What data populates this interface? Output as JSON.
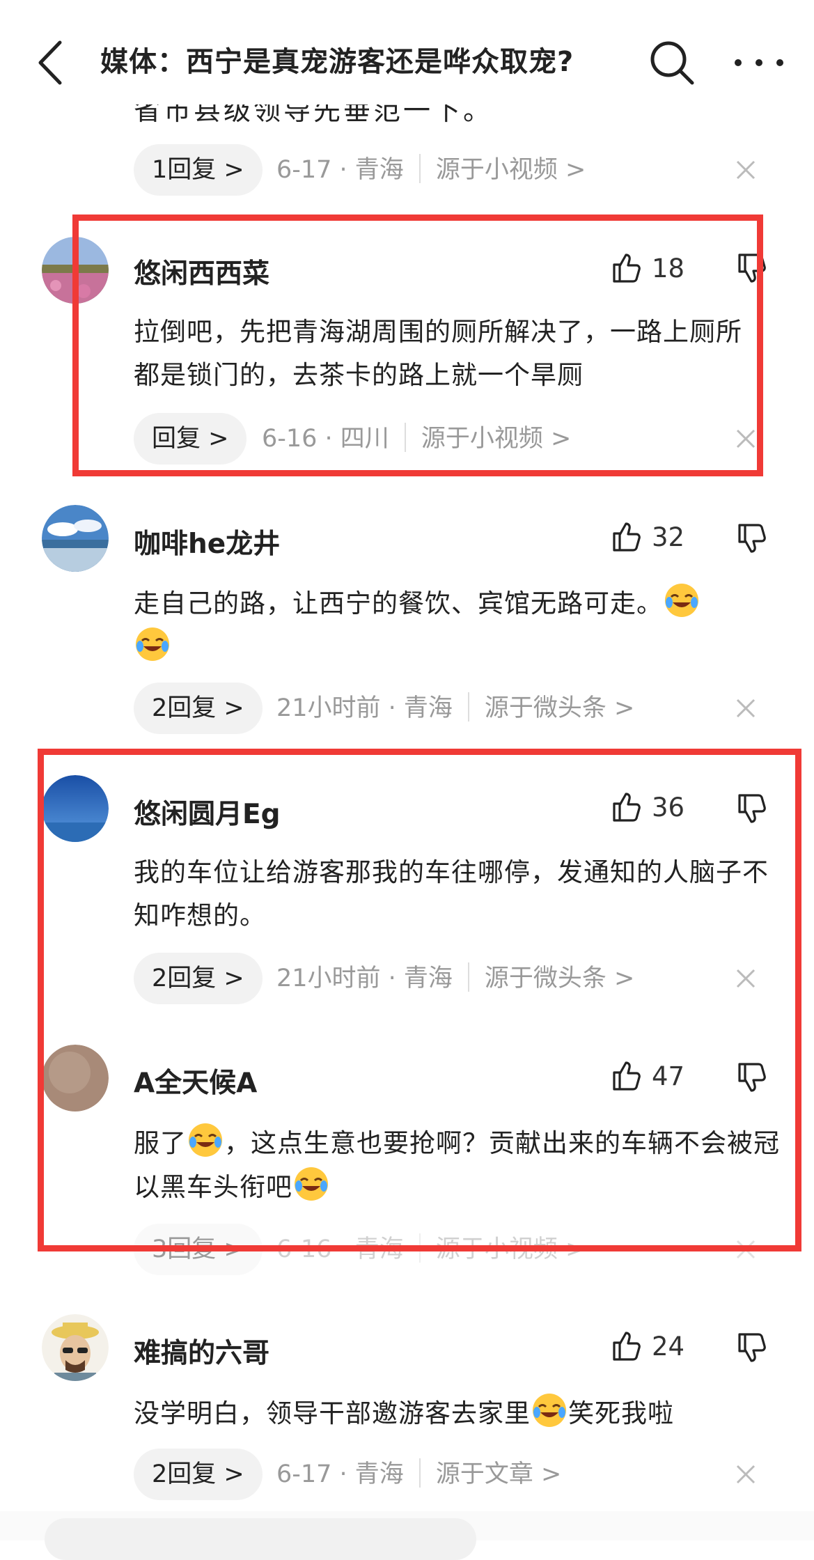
{
  "header": {
    "title": "媒体：西宁是真宠游客还是哗众取宠?"
  },
  "clipped_previous": {
    "text": "省市县级领导先垂范一下。",
    "meta": {
      "reply_label": "1回复 >",
      "date_location": "6-17 · 青海",
      "source": "源于小视频 >"
    }
  },
  "comments": [
    {
      "username": "悠闲西西菜",
      "likes": "18",
      "text": "拉倒吧，先把青海湖周围的厕所解决了，一路上厕所都是锁门的，去茶卡的路上就一个旱厕",
      "reply_label": "回复 >",
      "date_location": "6-16 · 四川",
      "source": "源于小视频 >"
    },
    {
      "username": "咖啡he龙井",
      "likes": "32",
      "text": "走自己的路，让西宁的餐饮、宾馆无路可走。",
      "reply_label": "2回复 >",
      "date_location": "21小时前 · 青海",
      "source": "源于微头条 >"
    },
    {
      "username": "悠闲圆月Eg",
      "likes": "36",
      "text": "我的车位让给游客那我的车往哪停，发通知的人脑子不知咋想的。",
      "reply_label": "2回复 >",
      "date_location": "21小时前 · 青海",
      "source": "源于微头条 >"
    },
    {
      "username": "A全天候A",
      "likes": "47",
      "text_a": "服了",
      "text_b": "，这点生意也要抢啊？贡献出来的车辆不会被冠以黑车头衔吧",
      "reply_label": "3回复 >",
      "date_location": "6-16 · 青海",
      "source": "源于小视频 >"
    },
    {
      "username": "难搞的六哥",
      "likes": "24",
      "text_a": "没学明白，领导干部邀游客去家里",
      "text_b": "笑死我啦",
      "reply_label": "2回复 >",
      "date_location": "6-17 · 青海",
      "source": "源于文章 >"
    }
  ],
  "icons": {
    "back": "back-arrow-icon",
    "search": "search-icon",
    "more": "more-icon",
    "like": "thumbs-up-icon",
    "dislike": "thumbs-down-icon",
    "close": "close-icon",
    "emoji": "crying-laughing-emoji"
  },
  "colors": {
    "highlight_box": "#f03a36",
    "reply_pill": "#f2f2f2",
    "meta_text": "#999999"
  }
}
